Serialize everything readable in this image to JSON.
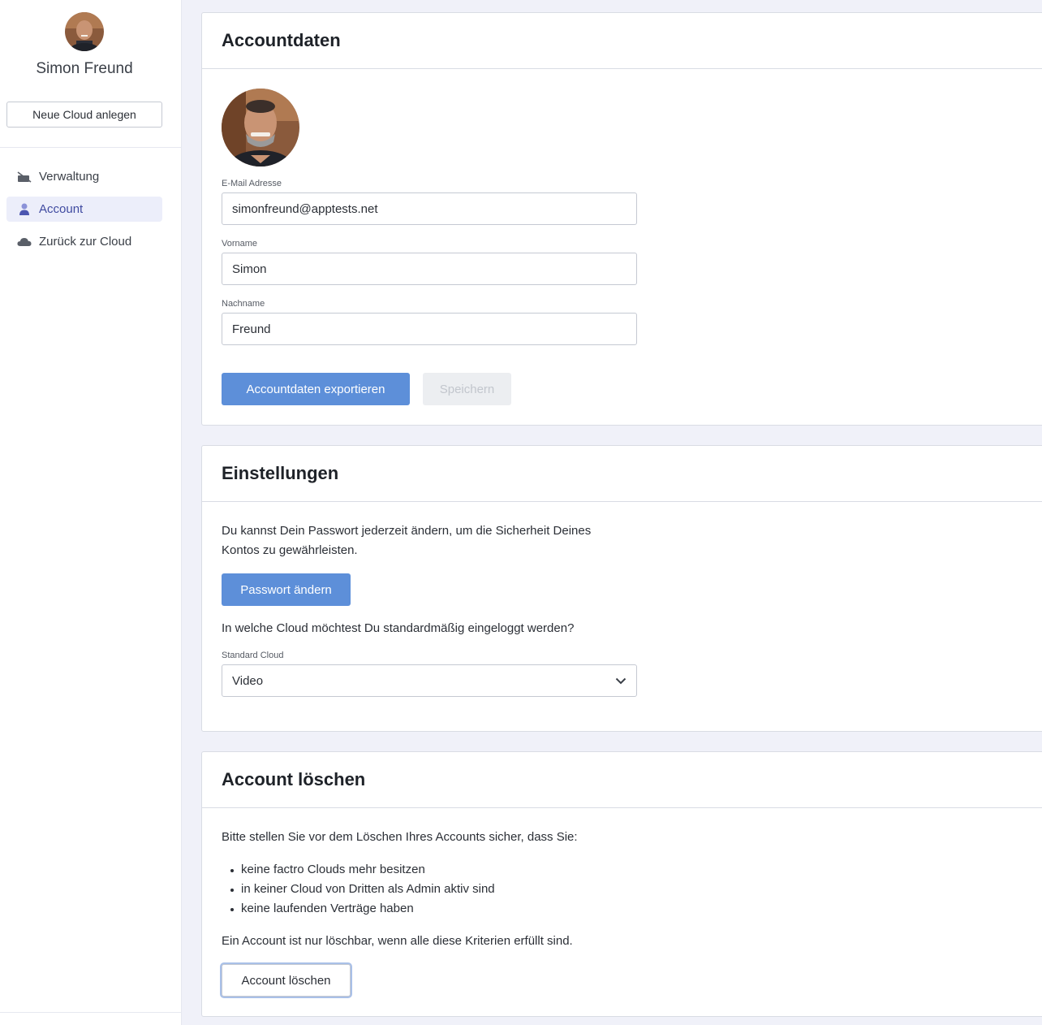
{
  "sidebar": {
    "user_name": "Simon Freund",
    "new_cloud_label": "Neue Cloud anlegen",
    "items": [
      {
        "label": "Verwaltung",
        "icon": "wrench-icon"
      },
      {
        "label": "Account",
        "icon": "user-icon"
      },
      {
        "label": "Zurück zur Cloud",
        "icon": "cloud-icon"
      }
    ],
    "active_item": "Account"
  },
  "account_data": {
    "title": "Accountdaten",
    "email": {
      "label": "E-Mail Adresse",
      "value": "simonfreund@apptests.net"
    },
    "first_name": {
      "label": "Vorname",
      "value": "Simon"
    },
    "last_name": {
      "label": "Nachname",
      "value": "Freund"
    },
    "export_label": "Accountdaten exportieren",
    "save_label": "Speichern"
  },
  "settings": {
    "title": "Einstellungen",
    "password_text_1": "Du kannst Dein Passwort jederzeit ändern, um die Sicherheit Deines",
    "password_text_2": "Kontos zu gewährleisten.",
    "change_password_label": "Passwort ändern",
    "default_cloud_question": "In welche Cloud möchtest Du standardmäßig eingeloggt werden?",
    "default_cloud_label": "Standard Cloud",
    "default_cloud_value": "Video"
  },
  "delete_account": {
    "title": "Account löschen",
    "intro": "Bitte stellen Sie vor dem Löschen Ihres Accounts sicher, dass Sie:",
    "criteria": [
      "keine factro Clouds mehr besitzen",
      "in keiner Cloud von Dritten als Admin aktiv sind",
      "keine laufenden Verträge haben"
    ],
    "note": "Ein Account ist nur löschbar, wenn alle diese Kriterien erfüllt sind.",
    "delete_label": "Account löschen"
  },
  "colors": {
    "primary": "#5d8fd9",
    "active_nav_bg": "#eceefa",
    "active_nav_text": "#3f4aa0",
    "page_bg": "#f0f1f9"
  }
}
